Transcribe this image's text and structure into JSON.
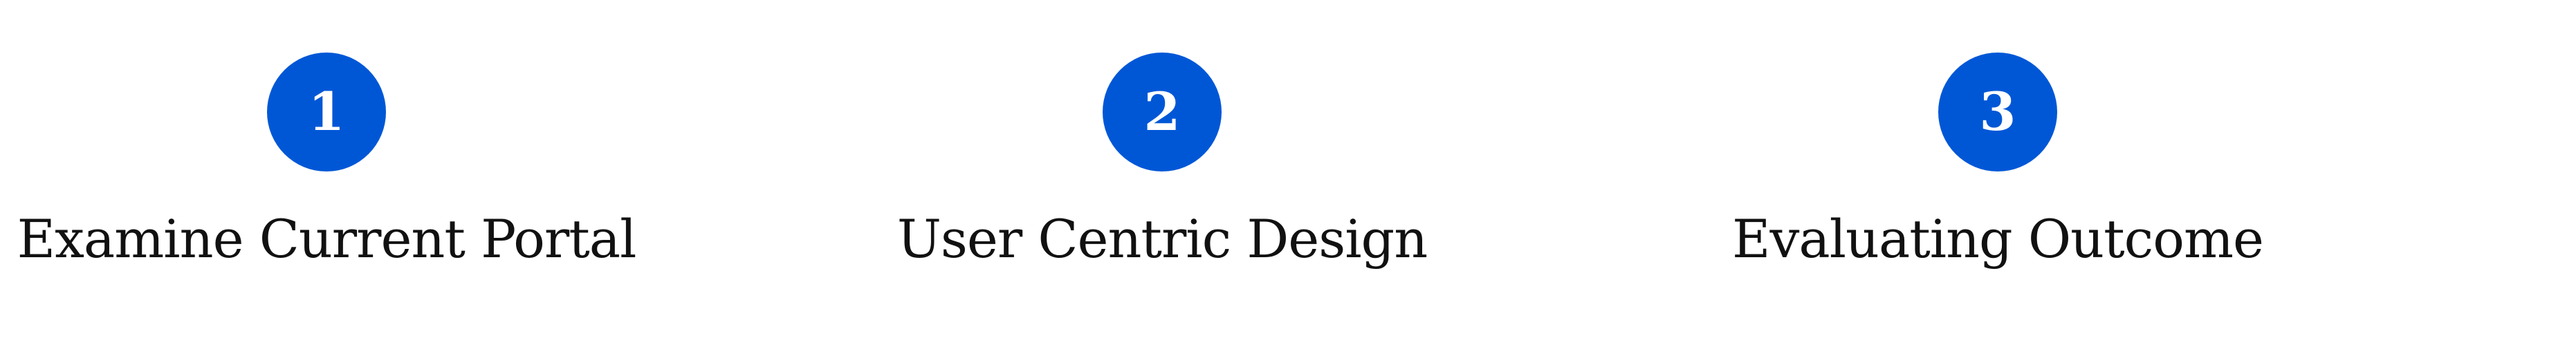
{
  "steps": [
    {
      "number": "1",
      "label": "Examine Current Portal"
    },
    {
      "number": "2",
      "label": "User Centric Design"
    },
    {
      "number": "3",
      "label": "Evaluating Outcome"
    }
  ],
  "colors": {
    "badge_fill": "#0057d6",
    "badge_text": "#ffffff",
    "label_text": "#111111"
  }
}
